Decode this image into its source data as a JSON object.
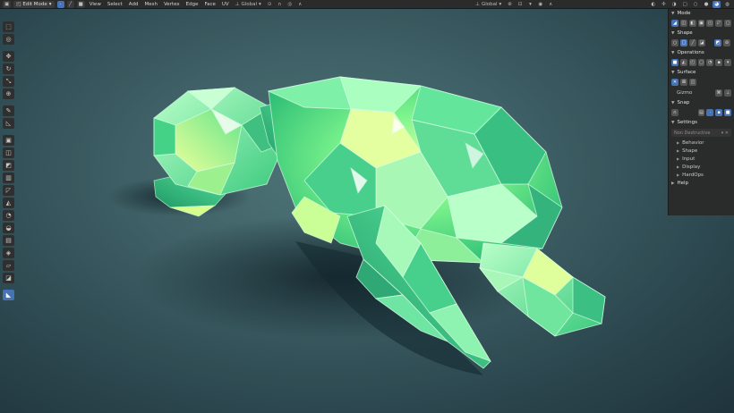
{
  "header": {
    "editor_icon": "cube-icon",
    "mode": "Edit Mode",
    "menus": [
      "View",
      "Select",
      "Add",
      "Mesh",
      "Vertex",
      "Edge",
      "Face",
      "UV"
    ],
    "transform_orientation": "Global",
    "pivot_orientation": "Global"
  },
  "toolbar": {
    "tools": [
      {
        "name": "select-box-tool",
        "glyph": "⬚",
        "active": false
      },
      {
        "name": "cursor-tool",
        "glyph": "◎",
        "active": false
      },
      {
        "name": "move-tool",
        "glyph": "✥",
        "active": false
      },
      {
        "name": "rotate-tool",
        "glyph": "↻",
        "active": false
      },
      {
        "name": "scale-tool",
        "glyph": "⤡",
        "active": false
      },
      {
        "name": "transform-tool",
        "glyph": "⊕",
        "active": false
      },
      {
        "name": "annotate-tool",
        "glyph": "✎",
        "active": false
      },
      {
        "name": "measure-tool",
        "glyph": "◺",
        "active": false
      },
      {
        "name": "extrude-tool",
        "glyph": "▣",
        "active": false
      },
      {
        "name": "inset-tool",
        "glyph": "◫",
        "active": false
      },
      {
        "name": "bevel-tool",
        "glyph": "◩",
        "active": false
      },
      {
        "name": "loop-cut-tool",
        "glyph": "▥",
        "active": false
      },
      {
        "name": "knife-tool",
        "glyph": "◸",
        "active": false
      },
      {
        "name": "poly-build-tool",
        "glyph": "◭",
        "active": false
      },
      {
        "name": "spin-tool",
        "glyph": "◔",
        "active": false
      },
      {
        "name": "smooth-tool",
        "glyph": "◒",
        "active": false
      },
      {
        "name": "edge-slide-tool",
        "glyph": "▤",
        "active": false
      },
      {
        "name": "shrink-fatten-tool",
        "glyph": "◈",
        "active": false
      },
      {
        "name": "shear-tool",
        "glyph": "▱",
        "active": false
      },
      {
        "name": "rip-tool",
        "glyph": "◪",
        "active": false
      },
      {
        "name": "boxcutter-tool",
        "glyph": "◣",
        "active": true
      }
    ]
  },
  "panel": {
    "sections": {
      "mode": "Mode",
      "shape": "Shape",
      "operations": "Operations",
      "surface": "Surface",
      "snap": "Snap",
      "settings": "Settings",
      "help": "Help"
    },
    "surface_label": "Gizmo",
    "settings_dropdown": "Non Destructive",
    "settings_items": [
      "Behavior",
      "Shape",
      "Input",
      "Display",
      "HardOps"
    ]
  },
  "colors": {
    "accent": "#4772b3",
    "crystal": "#6ff29a",
    "background": "#3e6066"
  }
}
